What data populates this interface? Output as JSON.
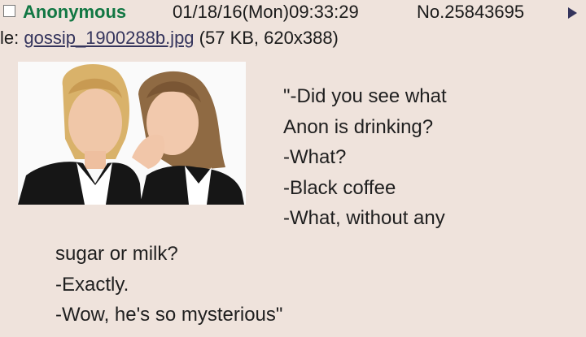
{
  "post": {
    "name": "Anonymous",
    "datetime": "01/18/16(Mon)09:33:29",
    "number": "No.25843695"
  },
  "file": {
    "prefix": "le: ",
    "filename": "gossip_1900288b.jpg",
    "meta": " (57 KB, 620x388)"
  },
  "thumbnail": {
    "alt": "two women whispering"
  },
  "comment": {
    "lines_right": [
      "\"-Did you see what",
      "Anon is drinking?",
      "-What?",
      "-Black coffee",
      "-What, without any"
    ],
    "lines_bottom": [
      "sugar or milk?",
      "-Exactly.",
      "-Wow, he's so mysterious\""
    ]
  },
  "colors": {
    "background": "#efe3dc",
    "name": "#117743",
    "link": "#34345c"
  },
  "icons": {
    "checkbox": "checkbox-icon",
    "arrow": "arrow-right-icon"
  }
}
